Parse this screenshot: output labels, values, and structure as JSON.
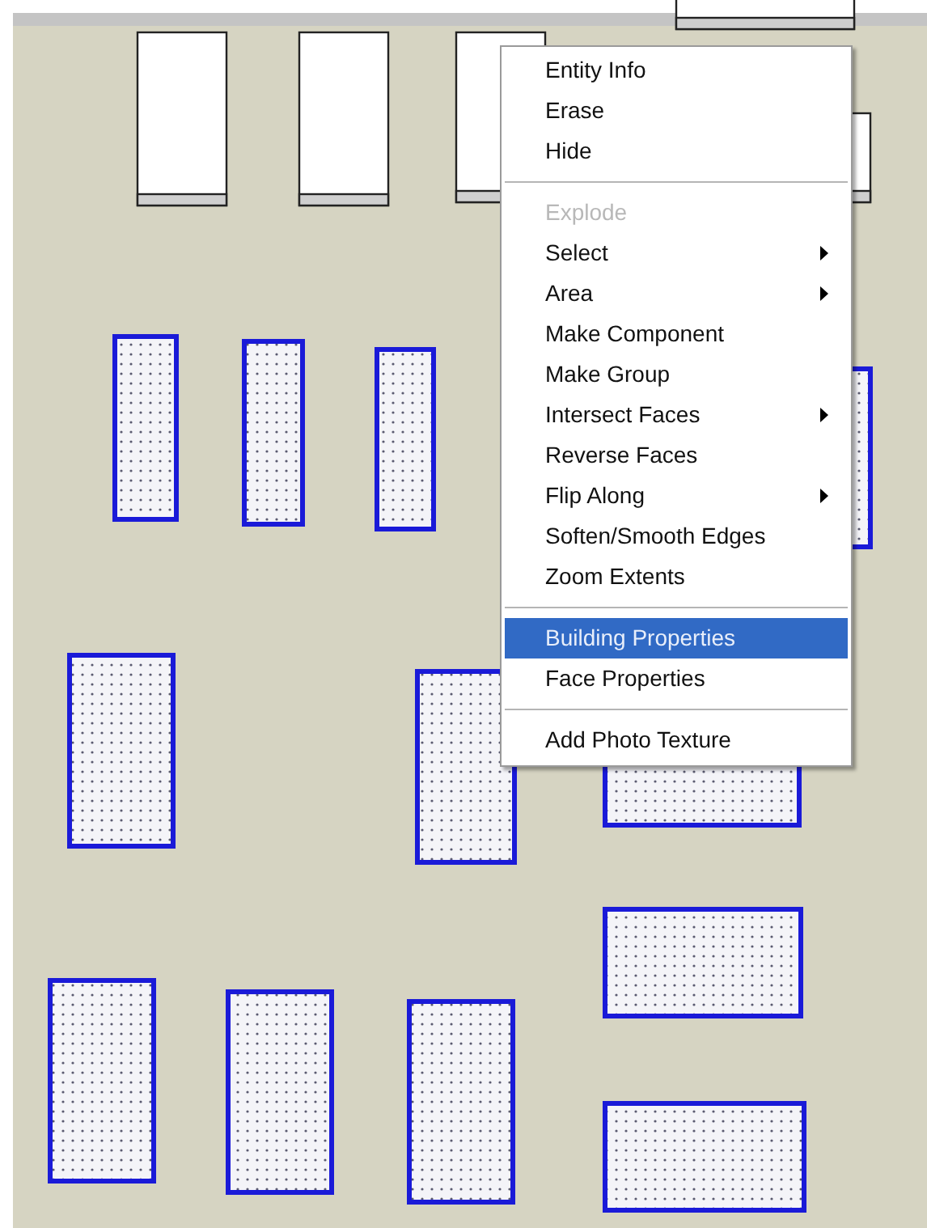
{
  "context_menu": {
    "groups": [
      [
        {
          "label": "Entity Info",
          "disabled": false,
          "selected": false,
          "submenu": false
        },
        {
          "label": "Erase",
          "disabled": false,
          "selected": false,
          "submenu": false
        },
        {
          "label": "Hide",
          "disabled": false,
          "selected": false,
          "submenu": false
        }
      ],
      [
        {
          "label": "Explode",
          "disabled": true,
          "selected": false,
          "submenu": false
        },
        {
          "label": "Select",
          "disabled": false,
          "selected": false,
          "submenu": true
        },
        {
          "label": "Area",
          "disabled": false,
          "selected": false,
          "submenu": true
        },
        {
          "label": "Make Component",
          "disabled": false,
          "selected": false,
          "submenu": false
        },
        {
          "label": "Make Group",
          "disabled": false,
          "selected": false,
          "submenu": false
        },
        {
          "label": "Intersect Faces",
          "disabled": false,
          "selected": false,
          "submenu": true
        },
        {
          "label": "Reverse Faces",
          "disabled": false,
          "selected": false,
          "submenu": false
        },
        {
          "label": "Flip Along",
          "disabled": false,
          "selected": false,
          "submenu": true
        },
        {
          "label": "Soften/Smooth Edges",
          "disabled": false,
          "selected": false,
          "submenu": false
        },
        {
          "label": "Zoom Extents",
          "disabled": false,
          "selected": false,
          "submenu": false
        }
      ],
      [
        {
          "label": "Building Properties",
          "disabled": false,
          "selected": true,
          "submenu": false
        },
        {
          "label": "Face Properties",
          "disabled": false,
          "selected": false,
          "submenu": false
        }
      ],
      [
        {
          "label": "Add Photo Texture",
          "disabled": false,
          "selected": false,
          "submenu": false
        }
      ]
    ]
  }
}
